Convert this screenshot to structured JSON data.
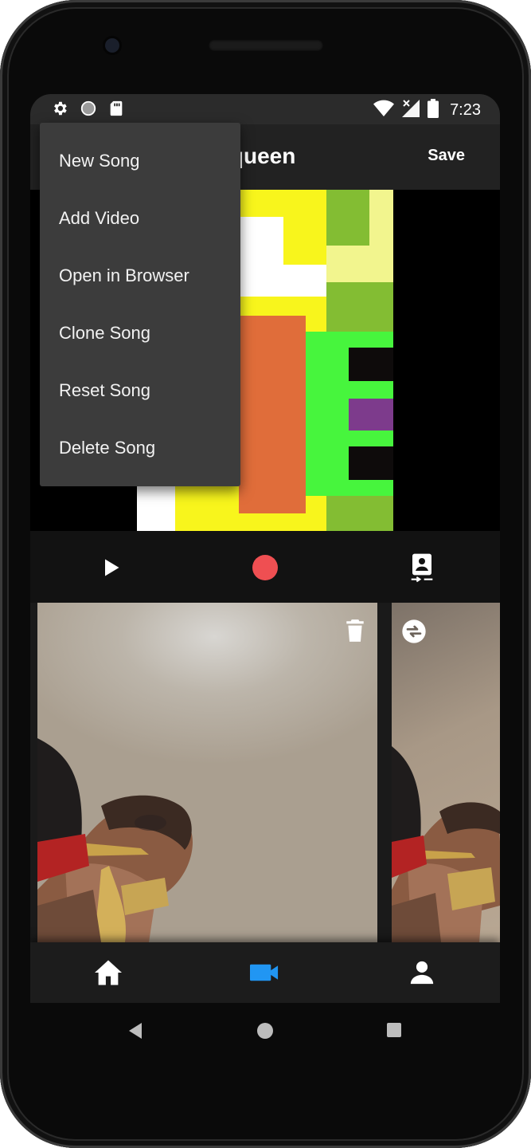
{
  "status_bar": {
    "time": "7:23",
    "left_icons": [
      "gear-icon",
      "circle-icon",
      "sd-card-icon"
    ],
    "right_icons": [
      "wifi-icon",
      "signal-icon",
      "battery-icon"
    ]
  },
  "app_bar": {
    "title_visible": "g queen",
    "save_label": "Save"
  },
  "overflow_menu": {
    "items": [
      {
        "label": "New Song"
      },
      {
        "label": "Add Video"
      },
      {
        "label": "Open in Browser"
      },
      {
        "label": "Clone Song"
      },
      {
        "label": "Reset Song"
      },
      {
        "label": "Delete Song"
      }
    ]
  },
  "controls": {
    "icons": [
      "play-icon",
      "record-icon",
      "switch-camera-icon"
    ],
    "record_color": "#ef4f52"
  },
  "clips": {
    "icons": [
      "trash-icon",
      "swap-icon"
    ]
  },
  "bottom_nav": {
    "items": [
      {
        "icon": "home-icon",
        "active": false
      },
      {
        "icon": "videocam-icon",
        "active": true
      },
      {
        "icon": "person-icon",
        "active": false
      }
    ],
    "active_color": "#2196f3",
    "inactive_color": "#ffffff"
  },
  "system_nav": {
    "icons": [
      "back-icon",
      "home-circle-icon",
      "recents-icon"
    ]
  }
}
